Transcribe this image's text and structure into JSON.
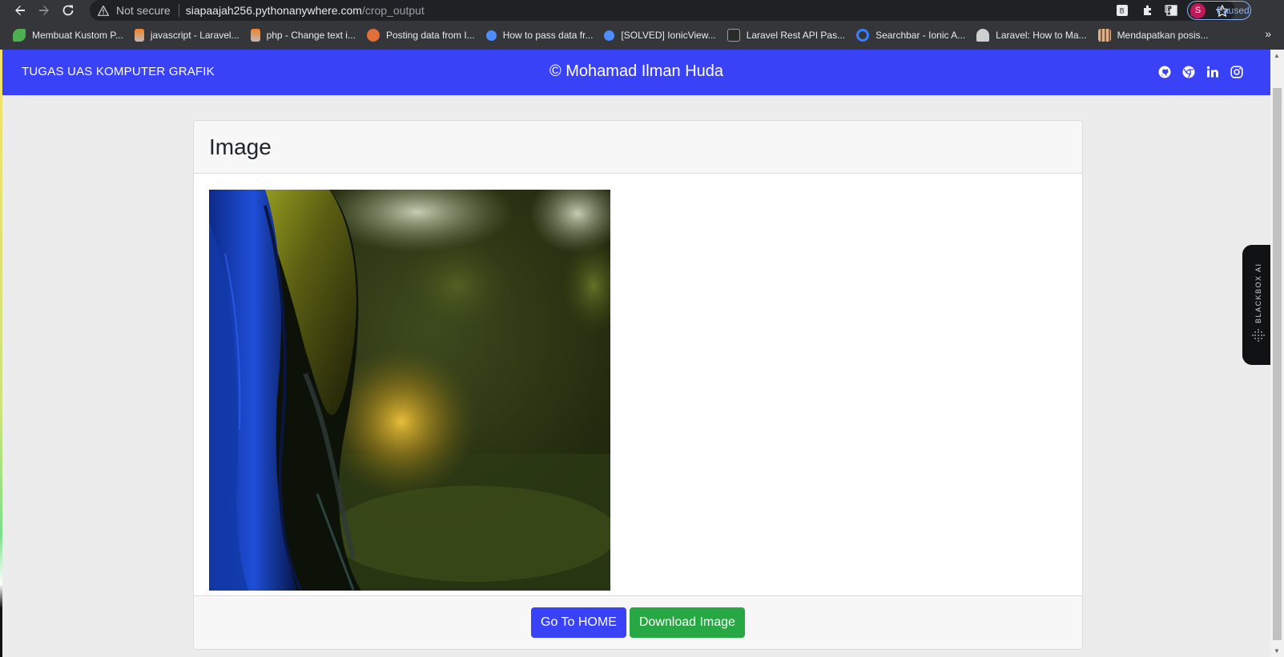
{
  "browser": {
    "security_label": "Not secure",
    "url_host": "siapaajah256.pythonanywhere.com",
    "url_path": "/crop_output",
    "profile_initial": "S",
    "profile_status": "Paused"
  },
  "bookmarks": [
    {
      "label": "Membuat Kustom P...",
      "icon": "leaf-icon",
      "color": "#4caf50"
    },
    {
      "label": "javascript - Laravel...",
      "icon": "stackoverflow-icon",
      "color": "#f48024"
    },
    {
      "label": "php - Change text i...",
      "icon": "stackoverflow-icon",
      "color": "#f48024"
    },
    {
      "label": "Posting data from I...",
      "icon": "avatar-icon",
      "color": "#e0703a"
    },
    {
      "label": "How to pass data fr...",
      "icon": "ionic-icon",
      "color": "#4d8dff"
    },
    {
      "label": "[SOLVED] IonicView...",
      "icon": "ionic-icon",
      "color": "#4d8dff"
    },
    {
      "label": "Laravel Rest API Pas...",
      "icon": "cat-icon",
      "color": "#9e9e9e"
    },
    {
      "label": "Searchbar - Ionic A...",
      "icon": "ionic-circle-icon",
      "color": "#3880ff"
    },
    {
      "label": "Laravel: How to Ma...",
      "icon": "people-icon",
      "color": "#cfcfcf"
    },
    {
      "label": "Mendapatkan posis...",
      "icon": "grid-icon",
      "color": "#d9b38c"
    }
  ],
  "navbar": {
    "brand": "TUGAS UAS KOMPUTER GRAFIK",
    "author": "© Mohamad Ilman Huda",
    "social_icons": [
      "github-icon",
      "chrome-icon",
      "linkedin-icon",
      "instagram-icon"
    ],
    "color": "#3a42f7"
  },
  "card": {
    "title": "Image",
    "home_button": "Go To HOME",
    "download_button": "Download Image"
  },
  "widget": {
    "label": "BLACKBOX AI"
  },
  "colors": {
    "primary": "#3a42f7",
    "success": "#28a745"
  }
}
